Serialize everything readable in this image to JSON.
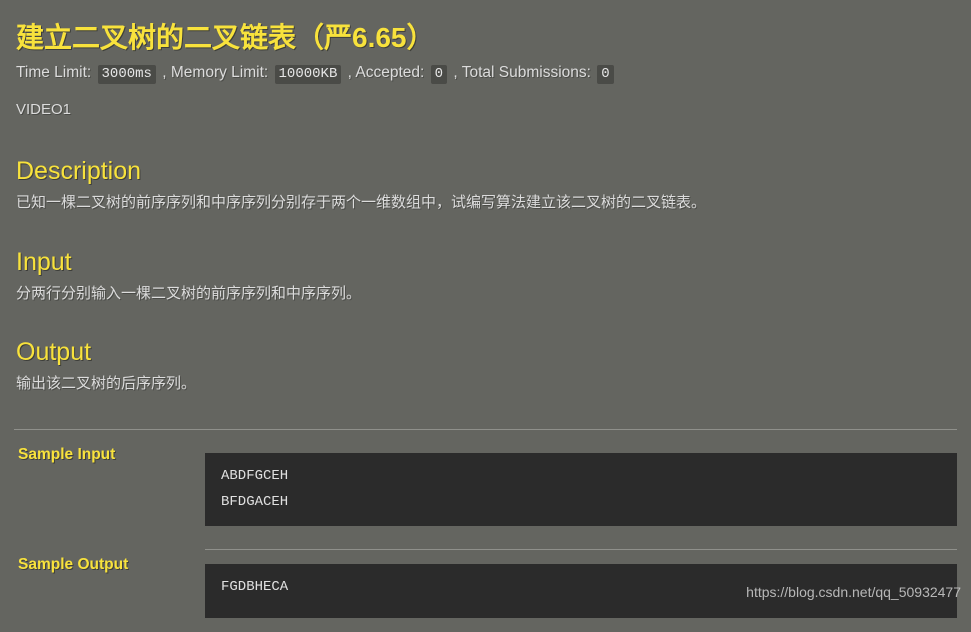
{
  "problem": {
    "title": "建立二叉树的二叉链表（严6.65）",
    "limits": {
      "time_limit_label": "Time Limit:",
      "time_limit_value": "3000ms",
      "separator_1": ",",
      "memory_limit_label": "Memory Limit:",
      "memory_limit_value": "10000KB",
      "separator_2": ",",
      "accepted_label": "Accepted:",
      "accepted_value": "0",
      "separator_3": ",",
      "submissions_label": "Total Submissions:",
      "submissions_value": "0"
    },
    "video_link": "VIDEO1"
  },
  "sections": {
    "description": {
      "heading": "Description",
      "body": "已知一棵二叉树的前序序列和中序序列分别存于两个一维数组中，试编写算法建立该二叉树的二叉链表。"
    },
    "input": {
      "heading": "Input",
      "body": "分两行分别输入一棵二叉树的前序序列和中序序列。"
    },
    "output": {
      "heading": "Output",
      "body": "输出该二叉树的后序序列。"
    }
  },
  "samples": {
    "input_label": "Sample Input",
    "input_lines": [
      "ABDFGCEH",
      "BFDGACEH"
    ],
    "output_label": "Sample Output",
    "output_lines": [
      "FGDBHECA"
    ]
  },
  "watermark": "https://blog.csdn.net/qq_50932477",
  "colors": {
    "page_background": "#646560",
    "accent_yellow": "#f8e23c",
    "code_background": "#2b2b2b",
    "body_text": "#dcdcdc",
    "badge_background": "#4a4b47",
    "divider": "#8f908b"
  }
}
